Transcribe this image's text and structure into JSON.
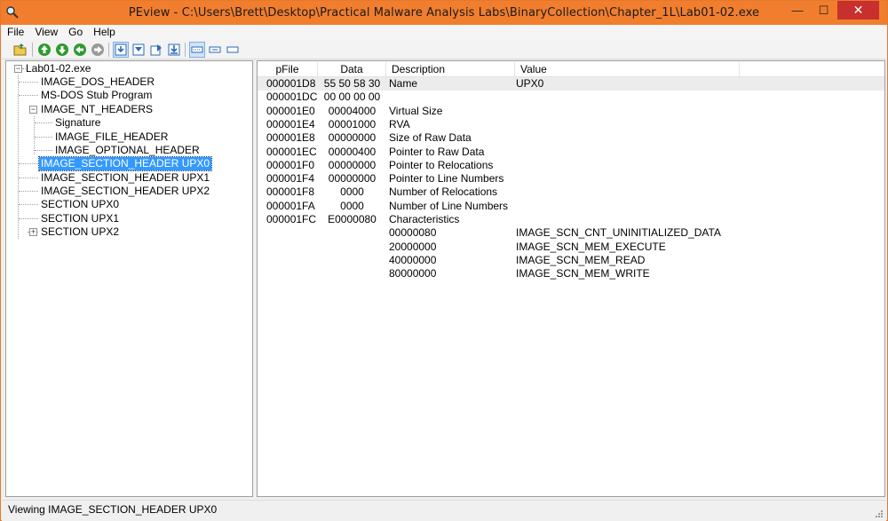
{
  "window": {
    "title": "PEview - C:\\Users\\Brett\\Desktop\\Practical Malware Analysis Labs\\BinaryCollection\\Chapter_1L\\Lab01-02.exe",
    "controls": {
      "minimize": "—",
      "maximize": "☐",
      "close": "✕"
    }
  },
  "menu": [
    "File",
    "View",
    "Go",
    "Help"
  ],
  "toolbar": {
    "icons": [
      "open-file-icon",
      "go-back-icon",
      "go-forward-icon",
      "go-up-icon",
      "go-down-icon",
      "view-mode-1-icon",
      "view-mode-2-icon",
      "view-mode-3-icon",
      "view-mode-4-icon",
      "list-view-icon",
      "detail-view-icon",
      "byte-view-icon"
    ]
  },
  "tree": {
    "root": "Lab01-02.exe",
    "items": [
      {
        "label": "IMAGE_DOS_HEADER"
      },
      {
        "label": "MS-DOS Stub Program"
      },
      {
        "label": "IMAGE_NT_HEADERS",
        "expander": "⊟"
      },
      {
        "label": "Signature"
      },
      {
        "label": "IMAGE_FILE_HEADER"
      },
      {
        "label": "IMAGE_OPTIONAL_HEADER"
      },
      {
        "label": "IMAGE_SECTION_HEADER UPX0",
        "selected": true
      },
      {
        "label": "IMAGE_SECTION_HEADER UPX1"
      },
      {
        "label": "IMAGE_SECTION_HEADER UPX2"
      },
      {
        "label": "SECTION UPX0"
      },
      {
        "label": "SECTION UPX1"
      },
      {
        "label": "SECTION UPX2",
        "expander": "⊞"
      }
    ]
  },
  "table": {
    "columns": [
      "pFile",
      "Data",
      "Description",
      "Value"
    ],
    "rows": [
      {
        "pfile": "000001D8",
        "data": "55  50  58  30",
        "desc": "Name",
        "value": "UPX0"
      },
      {
        "pfile": "000001DC",
        "data": "00  00  00  00",
        "desc": "",
        "value": ""
      },
      {
        "pfile": "000001E0",
        "data": "00004000",
        "desc": "Virtual Size",
        "value": ""
      },
      {
        "pfile": "000001E4",
        "data": "00001000",
        "desc": "RVA",
        "value": ""
      },
      {
        "pfile": "000001E8",
        "data": "00000000",
        "desc": "Size of Raw Data",
        "value": ""
      },
      {
        "pfile": "000001EC",
        "data": "00000400",
        "desc": "Pointer to Raw Data",
        "value": ""
      },
      {
        "pfile": "000001F0",
        "data": "00000000",
        "desc": "Pointer to Relocations",
        "value": ""
      },
      {
        "pfile": "000001F4",
        "data": "00000000",
        "desc": "Pointer to Line Numbers",
        "value": ""
      },
      {
        "pfile": "000001F8",
        "data": "0000",
        "desc": "Number of Relocations",
        "value": ""
      },
      {
        "pfile": "000001FA",
        "data": "0000",
        "desc": "Number of Line Numbers",
        "value": ""
      },
      {
        "pfile": "000001FC",
        "data": "E0000080",
        "desc": "Characteristics",
        "value": ""
      },
      {
        "pfile": "",
        "data": "",
        "desc": "00000080",
        "value": "IMAGE_SCN_CNT_UNINITIALIZED_DATA"
      },
      {
        "pfile": "",
        "data": "",
        "desc": "20000000",
        "value": "IMAGE_SCN_MEM_EXECUTE"
      },
      {
        "pfile": "",
        "data": "",
        "desc": "40000000",
        "value": "IMAGE_SCN_MEM_READ"
      },
      {
        "pfile": "",
        "data": "",
        "desc": "80000000",
        "value": "IMAGE_SCN_MEM_WRITE"
      }
    ]
  },
  "status": {
    "text": "Viewing IMAGE_SECTION_HEADER UPX0"
  },
  "colors": {
    "titlebar": "#f17e2e",
    "close_button": "#c7302d",
    "selection": "#3399ff"
  }
}
